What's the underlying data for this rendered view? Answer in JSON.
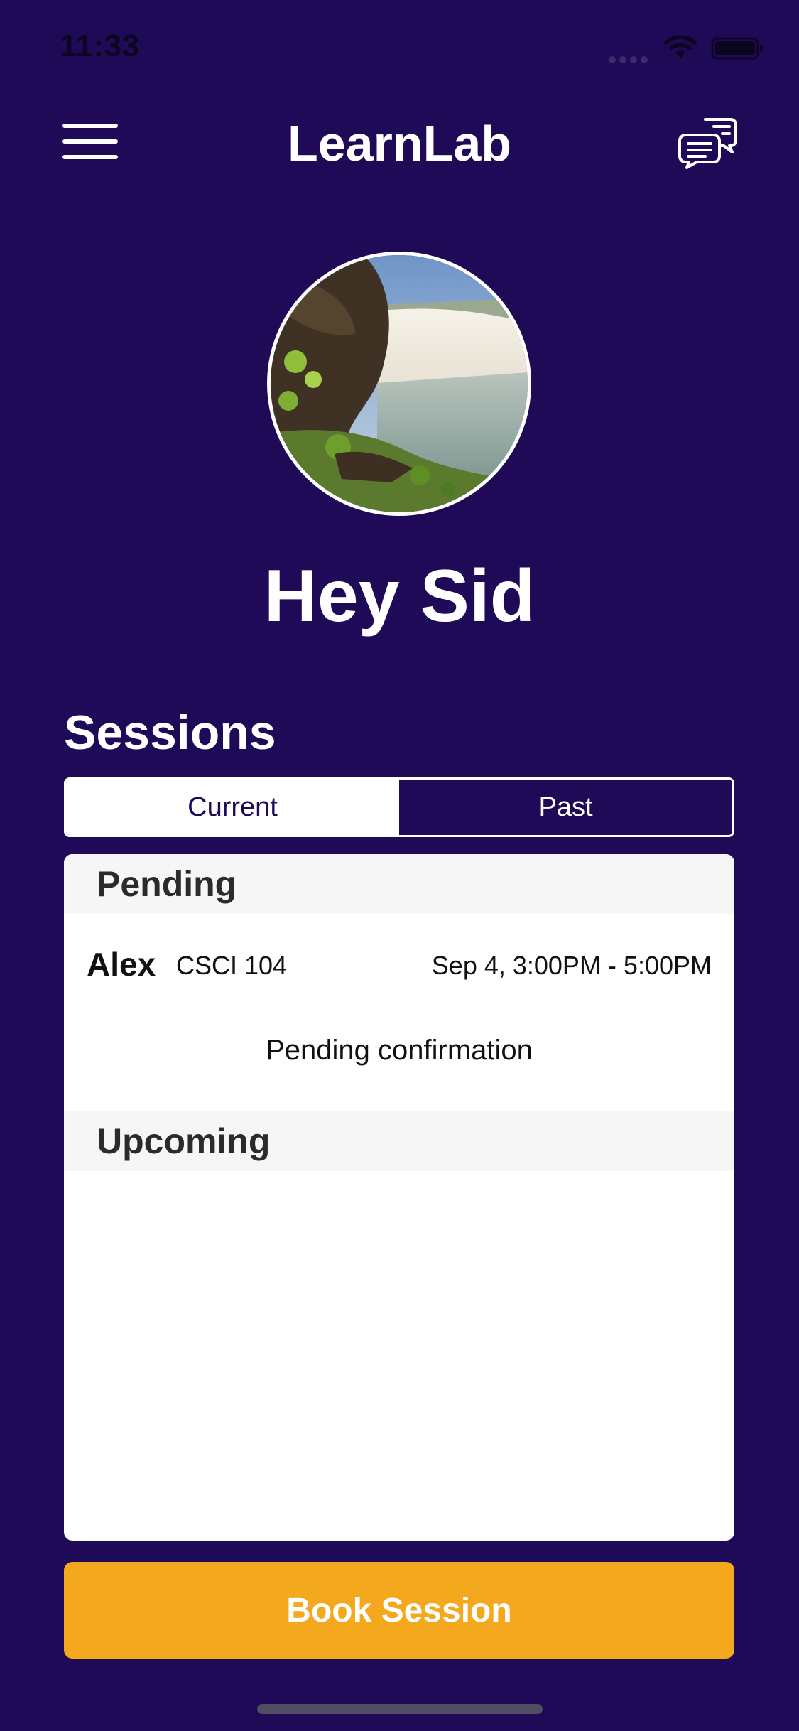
{
  "status_bar": {
    "time": "11:33"
  },
  "header": {
    "title": "LearnLab",
    "menu_icon": "hamburger-menu-icon",
    "chat_icon": "chat-bubbles-icon"
  },
  "profile": {
    "greeting": "Hey Sid"
  },
  "sessions": {
    "title": "Sessions",
    "tabs": [
      {
        "label": "Current",
        "selected": true
      },
      {
        "label": "Past",
        "selected": false
      }
    ],
    "pending": {
      "header": "Pending",
      "items": [
        {
          "name": "Alex",
          "course": "CSCI 104",
          "time": "Sep 4, 3:00PM - 5:00PM",
          "status": "Pending confirmation"
        }
      ]
    },
    "upcoming": {
      "header": "Upcoming",
      "items": []
    }
  },
  "actions": {
    "book_label": "Book Session"
  },
  "colors": {
    "background": "#1f0a58",
    "accent": "#f4a81d",
    "card": "#ffffff",
    "section_header_bg": "#f6f6f6"
  }
}
